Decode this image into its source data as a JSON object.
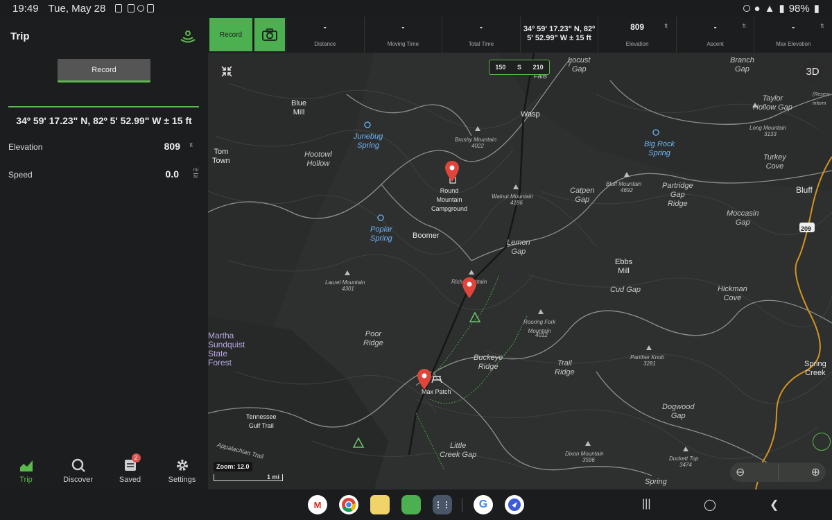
{
  "status_bar": {
    "time": "19:49",
    "date": "Tue, May 28",
    "battery": "98%"
  },
  "left_panel": {
    "title": "Trip",
    "record_label": "Record",
    "coordinates": "34º 59' 17.23\" N, 82º 5' 52.99\" W ± 15 ft",
    "elevation": {
      "label": "Elevation",
      "value": "809",
      "unit": "ft"
    },
    "speed": {
      "label": "Speed",
      "value": "0.0",
      "unit_top": "mi",
      "unit_bottom": "hr"
    }
  },
  "bottom_nav": {
    "items": [
      {
        "label": "Trip"
      },
      {
        "label": "Discover"
      },
      {
        "label": "Saved",
        "badge": "2"
      },
      {
        "label": "Settings"
      }
    ]
  },
  "stats_bar": {
    "record_label": "Record",
    "distance": {
      "value": "-",
      "label": "Distance"
    },
    "moving_time": {
      "value": "-",
      "label": "Moving Time"
    },
    "total_time": {
      "value": "-",
      "label": "Total Time"
    },
    "coords_line1": "34º 59' 17.23\" N, 82º",
    "coords_line2": "5' 52.99\" W ± 15 ft",
    "elevation": {
      "value": "809",
      "unit": "ft",
      "label": "Elevation"
    },
    "ascent": {
      "value": "-",
      "unit": "ft",
      "label": "Ascent"
    },
    "max_elevation": {
      "value": "-",
      "unit": "ft",
      "label": "Max Elevation"
    }
  },
  "map": {
    "compass": {
      "left": "150",
      "center": "S",
      "right": "210"
    },
    "threed_label": "3D",
    "zoom_label": "Zoom: 12.0",
    "scale_label": "1 mi",
    "labels": {
      "locust_gap": "Locust\nGap",
      "branch_gap": "Branch\nGap",
      "blue_mill": "Blue\nMill",
      "wasp": "Wasp",
      "taylor_hollow_gap": "Taylor\nHollow Gap",
      "junebug_spring": "Junebug\nSpring",
      "brushy_mountain": "Brushy Mountain",
      "brushy_elev": "4022",
      "long_mountain": "Long Mountain",
      "long_elev": "3133",
      "big_rock_spring": "Big Rock\nSpring",
      "tom_town": "Tom\nTown",
      "hootowl_hollow": "Hootowl\nHollow",
      "round_mountain_campground": "Round\nMountain\nCampground",
      "turkey_cove": "Turkey\nCove",
      "bluff_mountain": "Bluff Mountain",
      "bluff_mtn_elev": "4692",
      "partridge_gap_ridge": "Partridge\nGap\nRidge",
      "bluff": "Bluff",
      "walnut_mountain": "Walnut Mountain",
      "walnut_elev": "4186",
      "catpen_gap": "Catpen\nGap",
      "moccasin_gap": "Moccasin\nGap",
      "poplar_spring": "Poplar\nSpring",
      "boomer": "Boomer",
      "lemon_gap": "Lemon\nGap",
      "ebbs_mill": "Ebbs\nMill",
      "laurel_mountain": "Laurel Mountain",
      "laurel_elev": "4301",
      "rich_mountain": "Rich Mountain",
      "cud_gap": "Cud Gap",
      "hickman_cove": "Hickman\nCove",
      "martha_sundquist": "Martha\nSundquist\nState\nForest",
      "poor_ridge": "Poor\nRidge",
      "rooring_fork_mountain": "Rooring Fork\nMountain",
      "rooring_elev": "4012",
      "buckeye_ridge": "Buckeye\nRidge",
      "panther_knob": "Panther Knob",
      "panther_elev": "3281",
      "trail_ridge": "Trail\nRidge",
      "spring_creek": "Spring\nCreek",
      "max_patch": "Max Patch",
      "tennessee_gulf_trail": "Tennessee\nGulf Trail",
      "dogwood_gap": "Dogwood\nGap",
      "appalachian_trail": "Appalachian Trail",
      "little_creek_gap": "Little\nCreek Gap",
      "dixon_mountain": "Dixon Mountain",
      "dixon_elev": "3596",
      "duckett_top": "Duckett Top",
      "duckett_elev": "3474",
      "spring": "Spring",
      "route_209": "209",
      "falls": "Falls",
      "reserve_info": "(Reserv\ninform"
    }
  },
  "colors": {
    "accent": "#5bb84d",
    "pin": "#e0443a",
    "water_label": "#6fb6ff",
    "route_orange": "#d4931f"
  }
}
